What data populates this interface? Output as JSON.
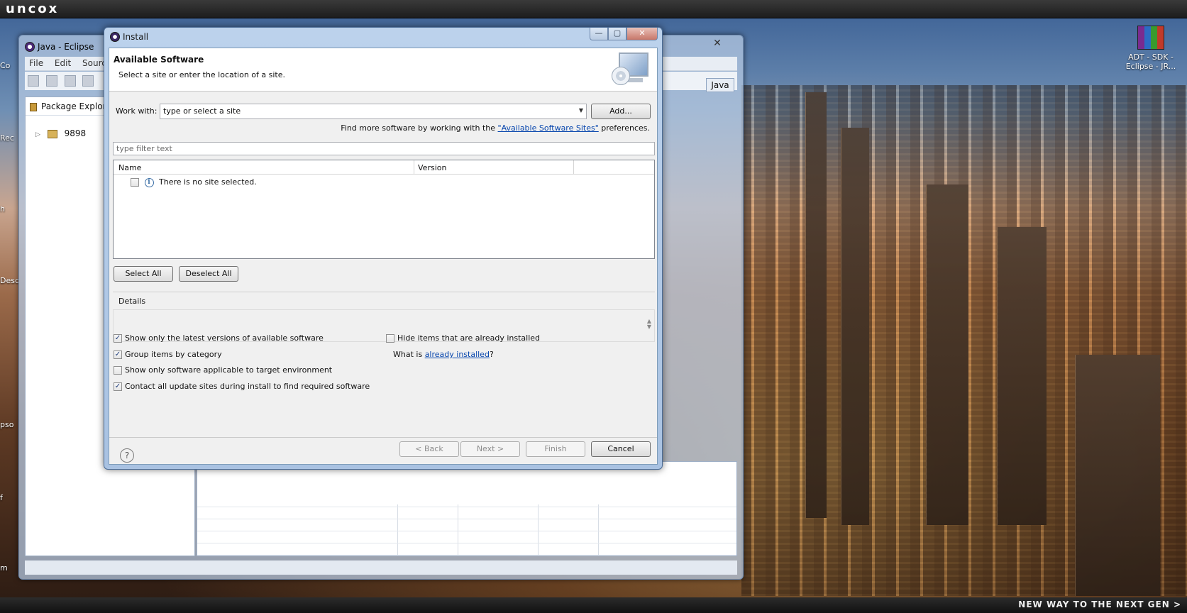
{
  "desktop": {
    "brand": "uncox",
    "tagline": "NEW WAY TO THE NEXT GEN >",
    "shortcut_label": "ADT - SDK - Eclipse - JR...",
    "left_labels": [
      "Co",
      "Rec",
      "h",
      "Desc",
      "pso",
      "f",
      "m"
    ]
  },
  "eclipse": {
    "title": "Java - Eclipse",
    "menu": [
      "File",
      "Edit",
      "Source"
    ],
    "perspective": "Java",
    "package_explorer": {
      "title": "Package Explorer",
      "project": "9898"
    }
  },
  "dialog": {
    "title": "Install",
    "window_controls": {
      "minimize": "—",
      "maximize": "▢",
      "close": "✕"
    },
    "header_title": "Available Software",
    "header_subtitle": "Select a site or enter the location of a site.",
    "work_with_label": "Work with:",
    "work_with_value": "type or select a site",
    "add_button": "Add...",
    "find_more_prefix": "Find more software by working with the ",
    "find_more_link": "\"Available Software Sites\"",
    "find_more_suffix": " preferences.",
    "filter_placeholder": "type filter text",
    "table": {
      "columns": [
        "Name",
        "Version"
      ],
      "rows": [
        {
          "name": "There is no site selected.",
          "checked": false
        }
      ]
    },
    "select_all": "Select All",
    "deselect_all": "Deselect All",
    "details_label": "Details",
    "options": [
      {
        "label": "Show only the latest versions of available software",
        "checked": true
      },
      {
        "label": "Group items by category",
        "checked": true
      },
      {
        "label": "Show only software applicable to target environment",
        "checked": false
      },
      {
        "label": "Contact all update sites during install to find required software",
        "checked": true
      },
      {
        "label": "Hide items that are already installed",
        "checked": false
      }
    ],
    "what_is_prefix": "What is ",
    "what_is_link": "already installed",
    "what_is_suffix": "?",
    "buttons": {
      "back": "< Back",
      "next": "Next >",
      "finish": "Finish",
      "cancel": "Cancel"
    }
  }
}
